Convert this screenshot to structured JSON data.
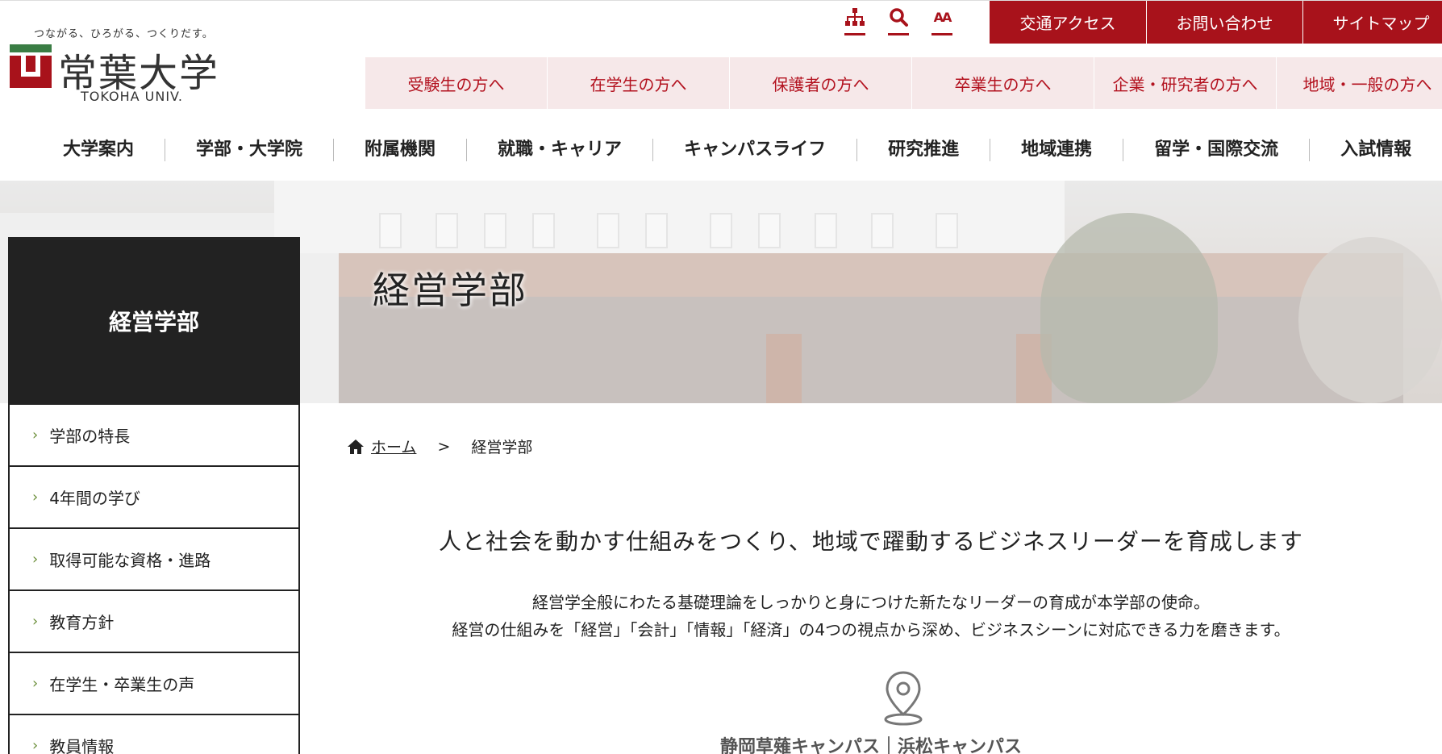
{
  "header": {
    "tagline": "つながる、ひろがる、つくりだす。",
    "logo_name": "常葉大学",
    "logo_en": "TOKOHA UNIV.",
    "util_icons": [
      {
        "name": "sitemap-icon"
      },
      {
        "name": "search-icon"
      },
      {
        "name": "font-size-icon",
        "text": "AA"
      }
    ],
    "util_links": [
      "交通アクセス",
      "お問い合わせ",
      "サイトマップ"
    ],
    "audience": [
      "受験生の方へ",
      "在学生の方へ",
      "保護者の方へ",
      "卒業生の方へ",
      "企業・研究者の方へ",
      "地域・一般の方へ"
    ],
    "nav": [
      "大学案内",
      "学部・大学院",
      "附属機関",
      "就職・キャリア",
      "キャンパスライフ",
      "研究推進",
      "地域連携",
      "留学・国際交流",
      "入試情報"
    ]
  },
  "hero": {
    "title": "経営学部"
  },
  "sidebar": {
    "title": "経営学部",
    "items": [
      "学部の特長",
      "4年間の学び",
      "取得可能な資格・進路",
      "教育方針",
      "在学生・卒業生の声",
      "教員情報"
    ]
  },
  "breadcrumb": {
    "home": "ホーム",
    "separator": ">",
    "current": "経営学部"
  },
  "content": {
    "lead": "人と社会を動かす仕組みをつくり、地域で躍動するビジネスリーダーを育成します",
    "desc_line1": "経営学全般にわたる基礎理論をしっかりと身につけた新たなリーダーの育成が本学部の使命。",
    "desc_line2": "経営の仕組みを「経営」「会計」「情報」「経済」の4つの視点から深め、ビジネスシーンに対応できる力を磨きます。",
    "campus": "静岡草薙キャンパス｜浜松キャンパス"
  },
  "colors": {
    "brand_red": "#a8121b",
    "audience_bg": "#f6e8e9",
    "sidebar_dark": "#222222"
  }
}
